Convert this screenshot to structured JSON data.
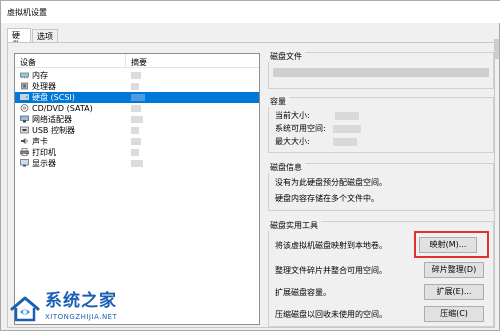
{
  "window": {
    "title": "虚拟机设置"
  },
  "tabs": [
    {
      "label": "硬件"
    },
    {
      "label": "选项"
    }
  ],
  "devices": {
    "header_device": "设备",
    "header_summary": "摘要",
    "items": [
      {
        "label": "内存",
        "icon": "memory-icon"
      },
      {
        "label": "处理器",
        "icon": "cpu-icon"
      },
      {
        "label": "硬盘 (SCSI)",
        "icon": "hard-disk-icon"
      },
      {
        "label": "CD/DVD (SATA)",
        "icon": "cd-dvd-icon"
      },
      {
        "label": "网络适配器",
        "icon": "network-adapter-icon"
      },
      {
        "label": "USB 控制器",
        "icon": "usb-controller-icon"
      },
      {
        "label": "声卡",
        "icon": "sound-card-icon"
      },
      {
        "label": "打印机",
        "icon": "printer-icon"
      },
      {
        "label": "显示器",
        "icon": "display-icon"
      }
    ]
  },
  "disk_file": {
    "title": "磁盘文件"
  },
  "capacity": {
    "title": "容量",
    "current_size_label": "当前大小:",
    "system_free_label": "系统可用空间:",
    "max_size_label": "最大大小:"
  },
  "disk_info": {
    "title": "磁盘信息",
    "line1": "没有为此硬盘预分配磁盘空间。",
    "line2": "硬盘内容存储在多个文件中。"
  },
  "utilities": {
    "title": "磁盘实用工具",
    "map_text": "将该虚拟机磁盘映射到本地卷。",
    "map_button": "映射(M)...",
    "defrag_text": "整理文件碎片并整合可用空间。",
    "defrag_button": "碎片整理(D)",
    "expand_text": "扩展磁盘容量。",
    "expand_button": "扩展(E)...",
    "compact_text": "压缩磁盘以回收未使用的空间。",
    "compact_button": "压缩(C)"
  },
  "watermark": {
    "name": "系统之家",
    "url": "XITONGZHIJIA.NET"
  },
  "colors": {
    "selection": "#0078d7",
    "highlight": "#e03030",
    "brand": "#1a5fb4"
  }
}
